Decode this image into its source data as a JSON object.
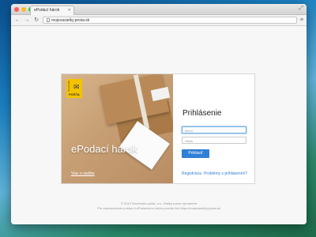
{
  "browser": {
    "tab_title": "ePodací hárok",
    "tab_close": "✕",
    "url": "mojezasielky.posta.sk",
    "resize_icon": "⤢",
    "back_icon": "←",
    "forward_icon": "→",
    "reload_icon": "↻",
    "menu_icon": "≡",
    "light_colors": [
      "#fc5f57",
      "#fdbc2e",
      "#28c940"
    ]
  },
  "brand": {
    "logo_text": "POŠTA",
    "logo_side": "Slovenská",
    "logo_mark": "✉",
    "logo_color": "#f4c300"
  },
  "hero": {
    "title": "ePodací hárok",
    "service_link": "Viac o službe"
  },
  "login": {
    "title": "Prihlásenie",
    "username_placeholder": "Meno",
    "password_placeholder": "Heslo",
    "submit_label": "Prihlásiť",
    "register_link": "Registrácia",
    "problems_link": "Problémy s prihlásením?",
    "accent_color": "#2f7fd6"
  },
  "footer": {
    "line1": "© 2013 Slovenská pošta, a.s. Všetky práva vyhradené",
    "line2": "Pre zabezpečenie prístup k ePodaciemu hárku použite link https://mojezasielky.posta.sk"
  }
}
